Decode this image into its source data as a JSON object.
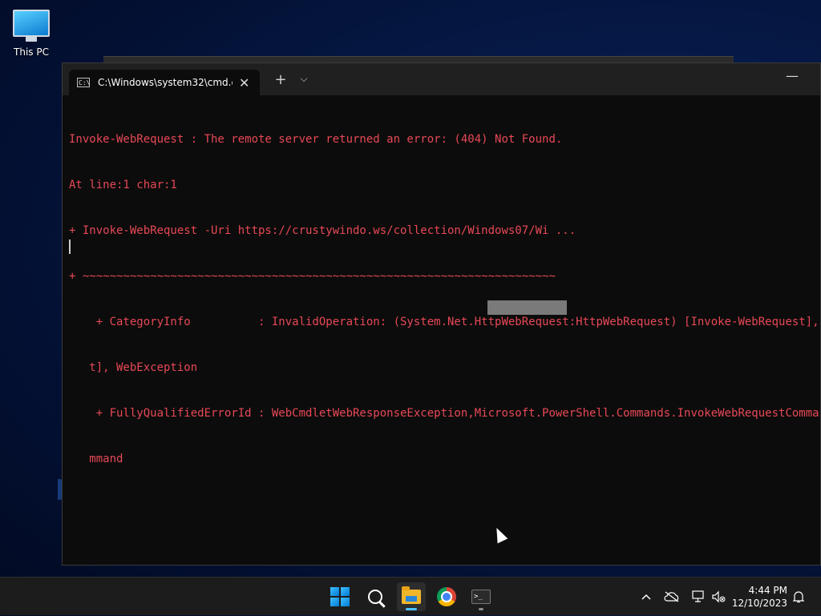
{
  "desktop": {
    "icons": [
      {
        "label": "This PC",
        "icon": "monitor-icon"
      }
    ]
  },
  "terminal": {
    "tab_title": "C:\\Windows\\system32\\cmd.e:",
    "tab_icon": "cmd-icon",
    "new_tab_glyph": "+",
    "dropdown_glyph": "⌵",
    "close_glyph": "✕",
    "minimize_glyph": "—",
    "text_color": "#e74856",
    "lines": [
      "Invoke-WebRequest : The remote server returned an error: (404) Not Found.",
      "At line:1 char:1",
      "+ Invoke-WebRequest -Uri https://crustywindo.ws/collection/Windows07/Wi ...",
      "+ ~~~~~~~~~~~~~~~~~~~~~~~~~~~~~~~~~~~~~~~~~~~~~~~~~~~~~~~~~~~~~~~~~~~~~~",
      "    + CategoryInfo          : InvalidOperation: (System.Net.HttpWebRequest:HttpWebRequest) [Invoke-WebRequest], WebException",
      "   t], WebException",
      "    + FullyQualifiedErrorId : WebCmdletWebResponseException,Microsoft.PowerShell.Commands.InvokeWebRequestCommand",
      "   mmand"
    ]
  },
  "taskbar": {
    "apps": [
      {
        "name": "start",
        "icon": "windows-logo-icon"
      },
      {
        "name": "search",
        "icon": "search-icon"
      },
      {
        "name": "file-explorer",
        "icon": "folder-icon",
        "active": true
      },
      {
        "name": "chrome",
        "icon": "chrome-icon"
      },
      {
        "name": "terminal",
        "icon": "terminal-icon",
        "running": true
      }
    ],
    "tray": {
      "chevron": "^",
      "time": "4:44 PM",
      "date": "12/10/2023"
    }
  }
}
